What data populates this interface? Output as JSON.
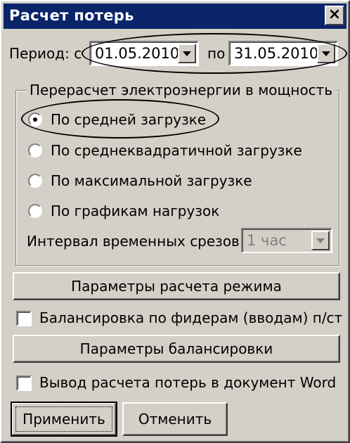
{
  "window": {
    "title": "Расчет потерь",
    "close_glyph": "×"
  },
  "period": {
    "label": "Период: с",
    "from": "01.05.2010",
    "to_label": "по",
    "to": "31.05.2010"
  },
  "recalc_group": {
    "title": "Перерасчет электроэнергии в мощность",
    "options": [
      {
        "label": "По средней загрузке",
        "selected": true
      },
      {
        "label": "По среднеквадратичной загрузке",
        "selected": false
      },
      {
        "label": "По максимальной загрузке",
        "selected": false
      },
      {
        "label": "По графикам нагрузок",
        "selected": false
      }
    ],
    "interval_label": "Интервал временных срезов",
    "interval_value": "1 час"
  },
  "buttons": {
    "mode_params": "Параметры расчета режима",
    "balance_params": "Параметры балансировки",
    "apply": "Применить",
    "cancel": "Отменить"
  },
  "checkboxes": {
    "balance_feeders": {
      "label": "Балансировка по фидерам (вводам) п/ст",
      "checked": false
    },
    "word_export": {
      "label": "Вывод расчета потерь в документ Word",
      "checked": false
    }
  },
  "icons": {
    "dropdown": "chevron-down-icon",
    "close": "close-icon"
  }
}
